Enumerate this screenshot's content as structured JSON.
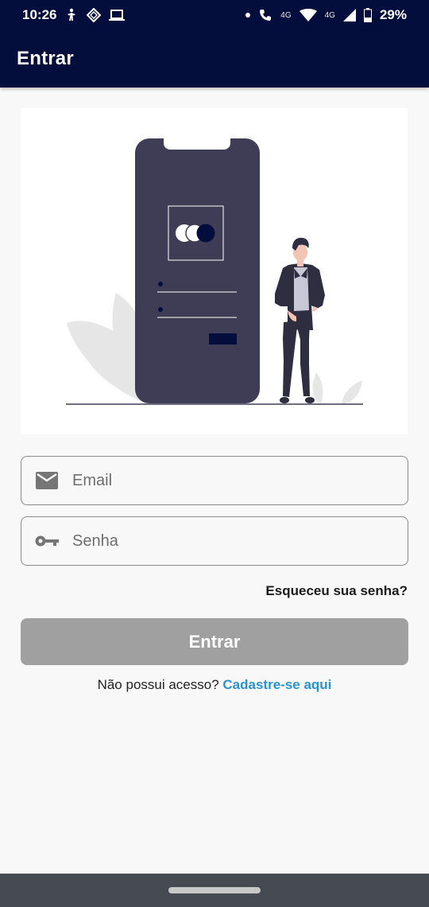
{
  "status_bar": {
    "time": "10:26",
    "signal_label_1": "4G",
    "signal_label_2": "4G",
    "battery": "29%",
    "icons": [
      "accessibility-icon",
      "diamond-icon",
      "laptop-icon",
      "dot-icon",
      "call-icon",
      "wifi-icon",
      "signal-icon",
      "battery-icon"
    ]
  },
  "app_bar": {
    "title": "Entrar"
  },
  "form": {
    "email_placeholder": "Email",
    "senha_placeholder": "Senha",
    "forgot_label": "Esqueceu sua senha?",
    "submit_label": "Entrar"
  },
  "signup": {
    "prompt": "Não possui acesso?",
    "link": "Cadastre-se aqui"
  },
  "colors": {
    "app_bar": "#030e3d",
    "button_disabled": "#a0a0a0",
    "link": "#2893d4",
    "phone": "#3f3d56"
  }
}
